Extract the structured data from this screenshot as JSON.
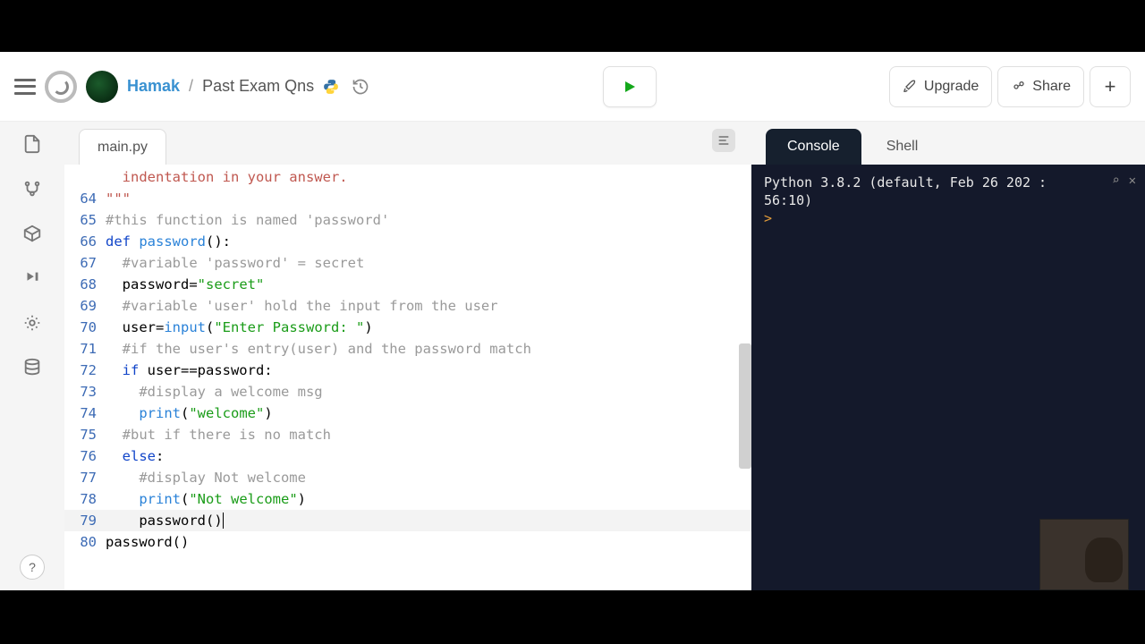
{
  "header": {
    "owner": "Hamak",
    "separator": "/",
    "project": "Past Exam Qns",
    "upgrade_label": "Upgrade",
    "share_label": "Share"
  },
  "file_tab": "main.py",
  "console": {
    "tab_active": "Console",
    "tab_inactive": "Shell",
    "line1": "Python 3.8.2 (default, Feb 26 202",
    "line1b": " :",
    "line2": "56:10)",
    "prompt": ">"
  },
  "code": {
    "l63": "  indentation in your answer.",
    "l64": "\"\"\"",
    "l65": "#this function is named 'password'",
    "l66a": "def ",
    "l66b": "password",
    "l66c": "():",
    "l67": "  #variable 'password' = secret",
    "l68a": "  password=",
    "l68b": "\"secret\"",
    "l69": "  #variable 'user' hold the input from the user",
    "l70a": "  user=",
    "l70b": "input",
    "l70c": "(",
    "l70d": "\"Enter Password: \"",
    "l70e": ")",
    "l71": "  #if the user's entry(user) and the password match",
    "l72a": "  if",
    "l72b": " user==password:",
    "l73": "    #display a welcome msg",
    "l74a": "    print",
    "l74b": "(",
    "l74c": "\"welcome\"",
    "l74d": ")",
    "l75": "  #but if there is no match",
    "l76a": "  else",
    "l76b": ":",
    "l77": "    #display Not welcome",
    "l78a": "    print",
    "l78b": "(",
    "l78c": "\"Not welcome\"",
    "l78d": ")",
    "l79": "    password()",
    "l80": "password()"
  },
  "gutter": [
    "",
    "64",
    "65",
    "66",
    "67",
    "68",
    "69",
    "70",
    "71",
    "72",
    "73",
    "74",
    "75",
    "76",
    "77",
    "78",
    "79",
    "80"
  ],
  "help_label": "?"
}
